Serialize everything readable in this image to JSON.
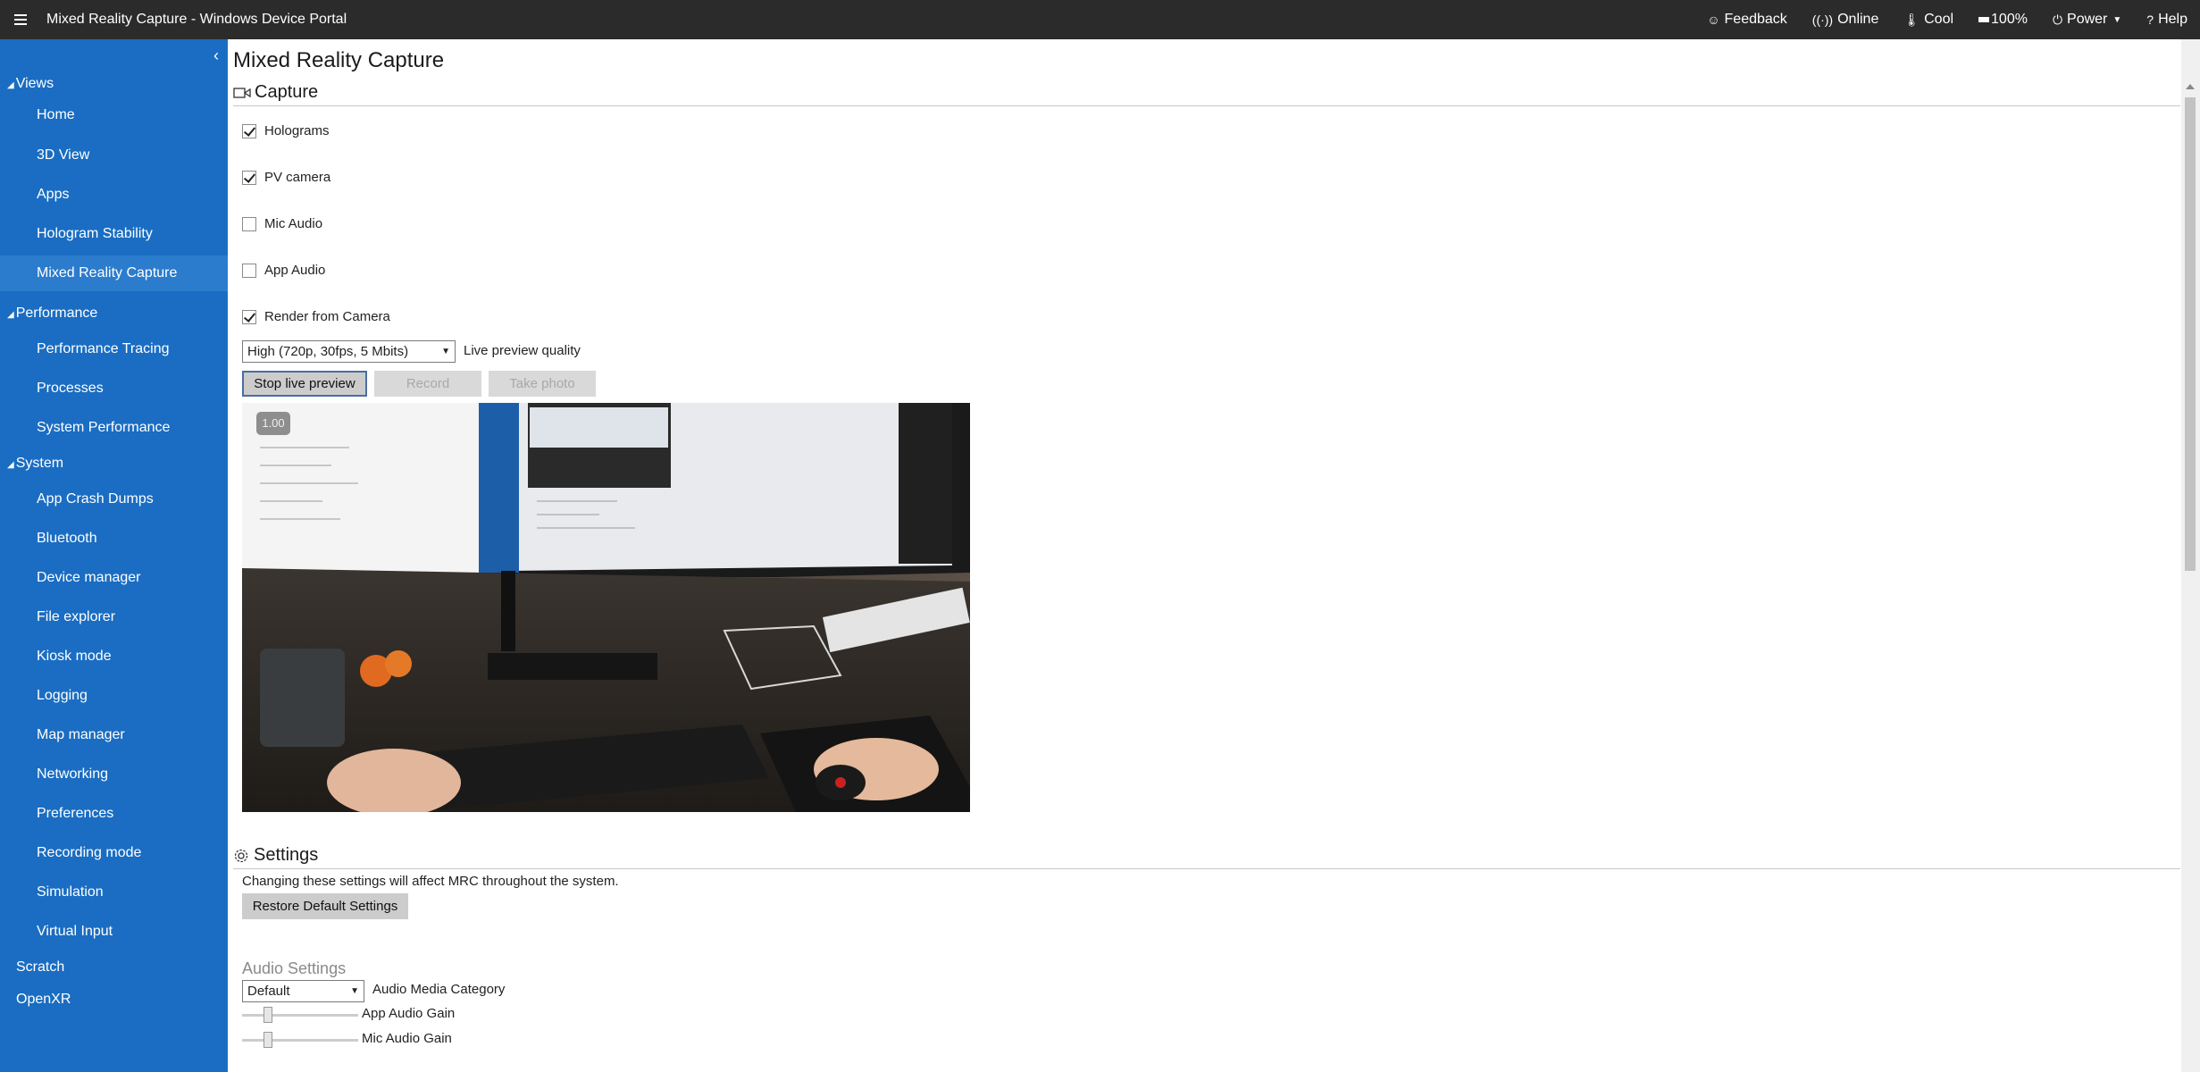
{
  "topbar": {
    "title": "Mixed Reality Capture - Windows Device Portal",
    "feedback": "Feedback",
    "online": "Online",
    "thermal": "Cool",
    "battery": "100%",
    "power": "Power",
    "help": "Help"
  },
  "sidebar": {
    "groups": {
      "views": "Views",
      "performance": "Performance",
      "system": "System"
    },
    "views_items": [
      "Home",
      "3D View",
      "Apps",
      "Hologram Stability",
      "Mixed Reality Capture"
    ],
    "performance_items": [
      "Performance Tracing",
      "Processes",
      "System Performance"
    ],
    "system_items": [
      "App Crash Dumps",
      "Bluetooth",
      "Device manager",
      "File explorer",
      "Kiosk mode",
      "Logging",
      "Map manager",
      "Networking",
      "Preferences",
      "Recording mode",
      "Simulation",
      "Virtual Input"
    ],
    "bottom_items": [
      "Scratch",
      "OpenXR"
    ],
    "active_item": "Mixed Reality Capture"
  },
  "main": {
    "page_title": "Mixed Reality Capture",
    "capture": {
      "heading": "Capture",
      "options": [
        {
          "label": "Holograms",
          "checked": true
        },
        {
          "label": "PV camera",
          "checked": true
        },
        {
          "label": "Mic Audio",
          "checked": false
        },
        {
          "label": "App Audio",
          "checked": false
        },
        {
          "label": "Render from Camera",
          "checked": true
        }
      ],
      "quality_value": "High (720p, 30fps, 5 Mbits)",
      "quality_label": "Live preview quality",
      "stop_preview": "Stop live preview",
      "record": "Record",
      "take_photo": "Take photo",
      "fps_badge": "1.00"
    },
    "settings": {
      "heading": "Settings",
      "note": "Changing these settings will affect MRC throughout the system.",
      "restore_button": "Restore Default Settings",
      "audio_heading": "Audio Settings",
      "audio_category_value": "Default",
      "audio_category_label": "Audio Media Category",
      "app_audio_gain_label": "App Audio Gain",
      "mic_audio_gain_label": "Mic Audio Gain",
      "app_audio_gain_level": 0.2,
      "mic_audio_gain_level": 0.2
    }
  }
}
